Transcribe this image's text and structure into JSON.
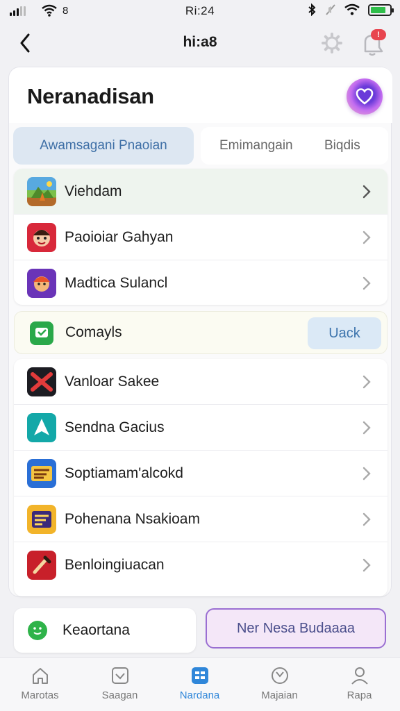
{
  "status_bar": {
    "carrier": "8",
    "time": "Ri:24",
    "battery_percent": 80
  },
  "nav": {
    "title": "hi:a8",
    "badge": "!"
  },
  "header": {
    "title": "Neranadisan"
  },
  "tabs": [
    {
      "label": "Awamsagani Pnaoian",
      "selected": true
    },
    {
      "label": "Emimangain",
      "selected": false
    },
    {
      "label": "Biqdis",
      "selected": false
    }
  ],
  "group_a": [
    {
      "label": "Viehdam",
      "icon": "game-landscape-icon"
    },
    {
      "label": "Paoioiar Gahyan",
      "icon": "red-character-icon"
    },
    {
      "label": "Madtica Sulancl",
      "icon": "purple-character-icon"
    }
  ],
  "connect": {
    "label": "Comayls",
    "button": "Uack",
    "icon": "green-app-icon"
  },
  "group_b": [
    {
      "label": "Vanloar Sakee",
      "icon": "black-red-x-icon"
    },
    {
      "label": "Sendna Gacius",
      "icon": "teal-a-icon"
    },
    {
      "label": "Soptiamam'alcokd",
      "icon": "blue-game-icon"
    },
    {
      "label": "Pohenana Nsakioam",
      "icon": "yellow-game-icon"
    },
    {
      "label": "Benloingiuacan",
      "icon": "red-tool-icon"
    }
  ],
  "actions": {
    "left_label": "Keaortana",
    "right_label": "Ner Nesa Budaaaa"
  },
  "tab_bar": [
    {
      "label": "Marotas",
      "icon": "home-icon",
      "active": false
    },
    {
      "label": "Saagan",
      "icon": "check-box-icon",
      "active": false
    },
    {
      "label": "Nardana",
      "icon": "grid-icon",
      "active": true
    },
    {
      "label": "Majaian",
      "icon": "clock-icon",
      "active": false
    },
    {
      "label": "Rapa",
      "icon": "person-icon",
      "active": false
    }
  ],
  "colors": {
    "accent": "#2f86d9",
    "tab_selected_bg": "#dde7f2",
    "badge": "#e8454f",
    "status_green": "#2fb34a",
    "action_border": "#9a6fd2"
  }
}
